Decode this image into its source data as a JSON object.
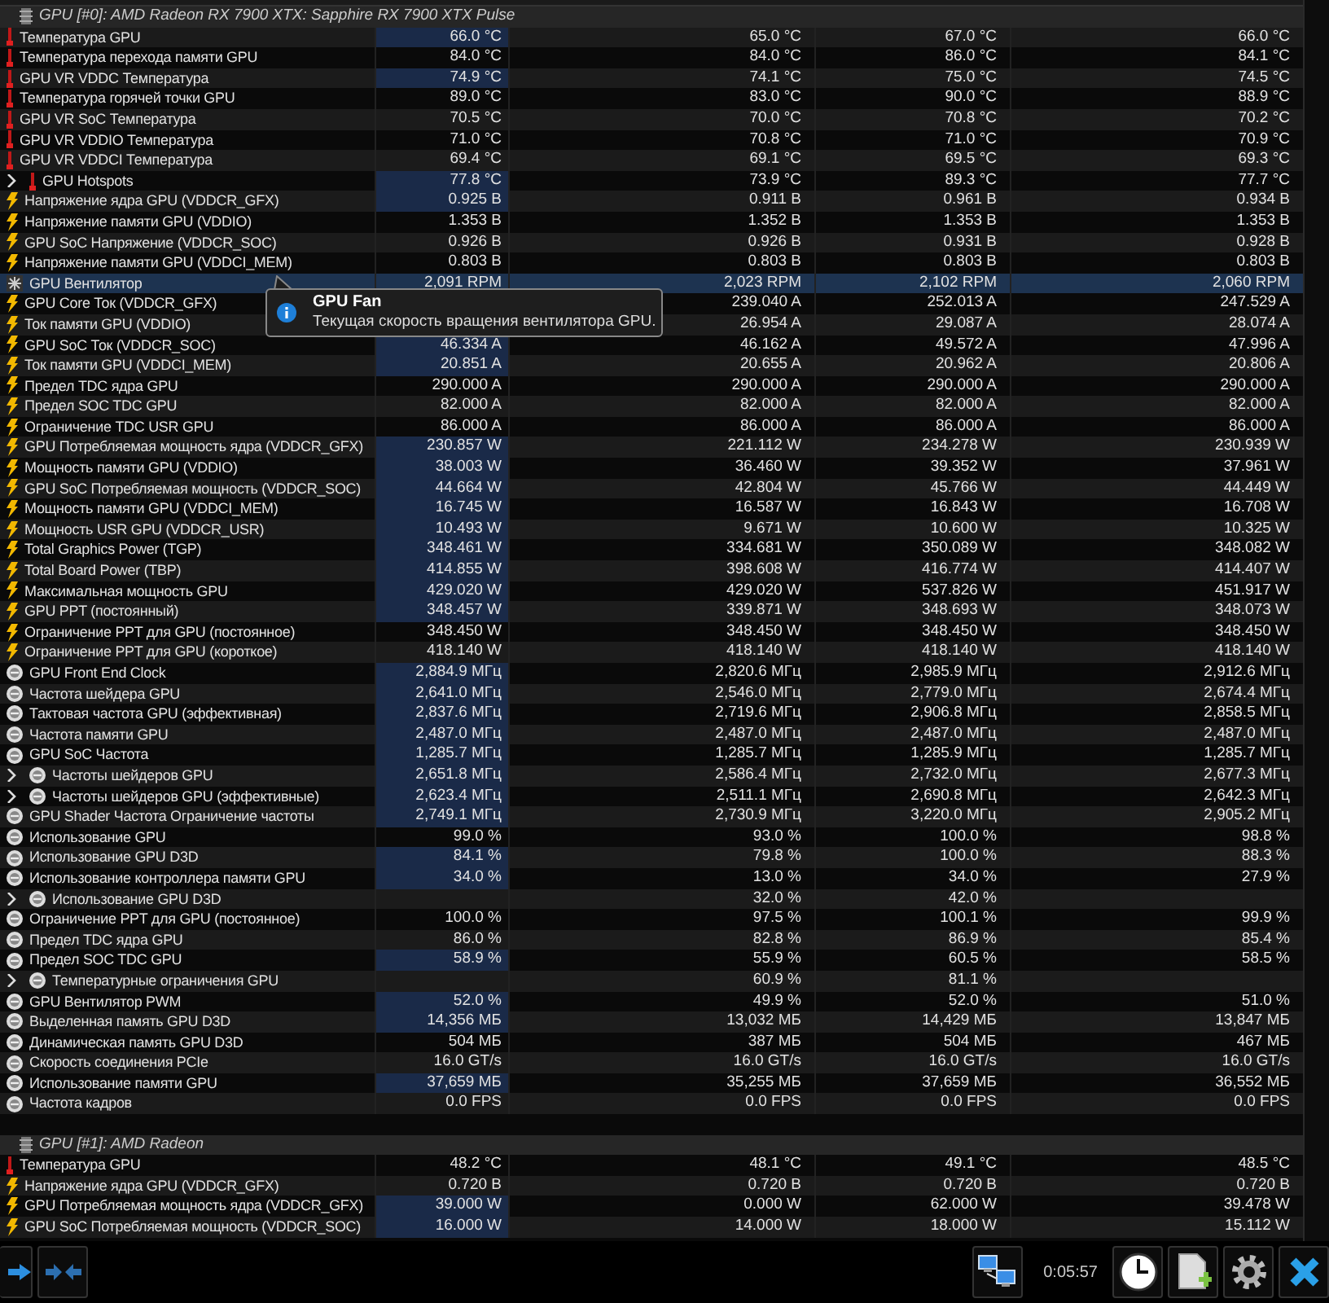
{
  "rows": [
    {
      "kind": "header",
      "label": "GPU [#0]: AMD Radeon RX 7900 XTX: Sapphire RX 7900 XTX Pulse"
    },
    {
      "kind": "temp",
      "label": "Температура GPU",
      "current": "66.0 °C",
      "min": "65.0 °C",
      "max": "67.0 °C",
      "avg": "66.0 °C",
      "highlighted": true,
      "selected": false
    },
    {
      "kind": "temp",
      "label": "Температура перехода памяти GPU",
      "current": "84.0 °C",
      "min": "84.0 °C",
      "max": "86.0 °C",
      "avg": "84.1 °C",
      "highlighted": false,
      "selected": false
    },
    {
      "kind": "temp",
      "label": "GPU VR VDDC Температура",
      "current": "74.9 °C",
      "min": "74.1 °C",
      "max": "75.0 °C",
      "avg": "74.5 °C",
      "highlighted": true,
      "selected": false
    },
    {
      "kind": "temp",
      "label": "Температура горячей точки GPU",
      "current": "89.0 °C",
      "min": "83.0 °C",
      "max": "90.0 °C",
      "avg": "88.9 °C",
      "highlighted": false,
      "selected": false
    },
    {
      "kind": "temp",
      "label": "GPU VR SoC Температура",
      "current": "70.5 °C",
      "min": "70.0 °C",
      "max": "70.8 °C",
      "avg": "70.2 °C",
      "highlighted": false,
      "selected": false
    },
    {
      "kind": "temp",
      "label": "GPU VR VDDIO Температура",
      "current": "71.0 °C",
      "min": "70.8 °C",
      "max": "71.0 °C",
      "avg": "70.9 °C",
      "highlighted": false,
      "selected": false
    },
    {
      "kind": "temp",
      "label": "GPU VR VDDCI Температура",
      "current": "69.4 °C",
      "min": "69.1 °C",
      "max": "69.5 °C",
      "avg": "69.3 °C",
      "highlighted": false,
      "selected": false
    },
    {
      "kind": "temp",
      "expanded": false,
      "label": "GPU Hotspots",
      "current": "77.8 °C",
      "min": "73.9 °C",
      "max": "89.3 °C",
      "avg": "77.7 °C",
      "highlighted": true,
      "selected": false
    },
    {
      "kind": "power",
      "label": "Напряжение ядра GPU (VDDCR_GFX)",
      "current": "0.925 В",
      "min": "0.911 В",
      "max": "0.961 В",
      "avg": "0.934 В",
      "highlighted": true,
      "selected": false
    },
    {
      "kind": "power",
      "label": "Напряжение памяти GPU (VDDIO)",
      "current": "1.353 В",
      "min": "1.352 В",
      "max": "1.353 В",
      "avg": "1.353 В",
      "highlighted": false,
      "selected": false
    },
    {
      "kind": "power",
      "label": "GPU SoC Напряжение (VDDCR_SOC)",
      "current": "0.926 В",
      "min": "0.926 В",
      "max": "0.931 В",
      "avg": "0.928 В",
      "highlighted": false,
      "selected": false
    },
    {
      "kind": "power",
      "label": "Напряжение памяти GPU (VDDCI_MEM)",
      "current": "0.803 В",
      "min": "0.803 В",
      "max": "0.803 В",
      "avg": "0.803 В",
      "highlighted": false,
      "selected": false
    },
    {
      "kind": "fan",
      "label": "GPU Вентилятор",
      "current": "2,091 RPM",
      "min": "2,023 RPM",
      "max": "2,102 RPM",
      "avg": "2,060 RPM",
      "highlighted": false,
      "selected": true
    },
    {
      "kind": "power",
      "label": "GPU Core Ток (VDDCR_GFX)",
      "min": "239.040 A",
      "max": "252.013 A",
      "avg": "247.529 A",
      "selected": false
    },
    {
      "kind": "power",
      "label": "Ток памяти GPU (VDDIO)",
      "min": "26.954 A",
      "max": "29.087 A",
      "avg": "28.074 A",
      "selected": false
    },
    {
      "kind": "power",
      "label": "GPU SoC Ток (VDDCR_SOC)",
      "current": "46.334 A",
      "min": "46.162 A",
      "max": "49.572 A",
      "avg": "47.996 A",
      "highlighted": true,
      "selected": false
    },
    {
      "kind": "power",
      "label": "Ток памяти GPU (VDDCI_MEM)",
      "current": "20.851 A",
      "min": "20.655 A",
      "max": "20.962 A",
      "avg": "20.806 A",
      "highlighted": true,
      "selected": false
    },
    {
      "kind": "power",
      "label": "Предел TDC ядра GPU",
      "current": "290.000 A",
      "min": "290.000 A",
      "max": "290.000 A",
      "avg": "290.000 A",
      "highlighted": false,
      "selected": false
    },
    {
      "kind": "power",
      "label": "Предел SOC TDC GPU",
      "current": "82.000 A",
      "min": "82.000 A",
      "max": "82.000 A",
      "avg": "82.000 A",
      "highlighted": false,
      "selected": false
    },
    {
      "kind": "power",
      "label": "Ограничение TDC USR GPU",
      "current": "86.000 A",
      "min": "86.000 A",
      "max": "86.000 A",
      "avg": "86.000 A",
      "highlighted": false,
      "selected": false
    },
    {
      "kind": "power",
      "label": "GPU Потребляемая мощность ядра (VDDCR_GFX)",
      "current": "230.857 W",
      "min": "221.112 W",
      "max": "234.278 W",
      "avg": "230.939 W",
      "highlighted": true,
      "selected": false
    },
    {
      "kind": "power",
      "label": "Мощность памяти GPU (VDDIO)",
      "current": "38.003 W",
      "min": "36.460 W",
      "max": "39.352 W",
      "avg": "37.961 W",
      "highlighted": true,
      "selected": false
    },
    {
      "kind": "power",
      "label": "GPU SoC Потребляемая мощность (VDDCR_SOC)",
      "current": "44.664 W",
      "min": "42.804 W",
      "max": "45.766 W",
      "avg": "44.449 W",
      "highlighted": true,
      "selected": false
    },
    {
      "kind": "power",
      "label": "Мощность памяти GPU (VDDCI_MEM)",
      "current": "16.745 W",
      "min": "16.587 W",
      "max": "16.843 W",
      "avg": "16.708 W",
      "highlighted": true,
      "selected": false
    },
    {
      "kind": "power",
      "label": "Мощность USR GPU (VDDCR_USR)",
      "current": "10.493 W",
      "min": "9.671 W",
      "max": "10.600 W",
      "avg": "10.325 W",
      "highlighted": true,
      "selected": false
    },
    {
      "kind": "power",
      "label": "Total Graphics Power (TGP)",
      "current": "348.461 W",
      "min": "334.681 W",
      "max": "350.089 W",
      "avg": "348.082 W",
      "highlighted": true,
      "selected": false
    },
    {
      "kind": "power",
      "label": "Total Board Power (TBP)",
      "current": "414.855 W",
      "min": "398.608 W",
      "max": "416.774 W",
      "avg": "414.407 W",
      "highlighted": true,
      "selected": false
    },
    {
      "kind": "power",
      "label": "Максимальная мощность GPU",
      "current": "429.020 W",
      "min": "429.020 W",
      "max": "537.826 W",
      "avg": "451.917 W",
      "highlighted": true,
      "selected": false
    },
    {
      "kind": "power",
      "label": "GPU PPT (постоянный)",
      "current": "348.457 W",
      "min": "339.871 W",
      "max": "348.693 W",
      "avg": "348.073 W",
      "highlighted": true,
      "selected": false
    },
    {
      "kind": "power",
      "label": "Ограничение PPT для GPU (постоянное)",
      "current": "348.450 W",
      "min": "348.450 W",
      "max": "348.450 W",
      "avg": "348.450 W",
      "highlighted": false,
      "selected": false
    },
    {
      "kind": "power",
      "label": "Ограничение PPT для GPU (короткое)",
      "current": "418.140 W",
      "min": "418.140 W",
      "max": "418.140 W",
      "avg": "418.140 W",
      "highlighted": false,
      "selected": false
    },
    {
      "kind": "clock",
      "label": "GPU Front End Clock",
      "current": "2,884.9 МГц",
      "min": "2,820.6 МГц",
      "max": "2,985.9 МГц",
      "avg": "2,912.6 МГц",
      "highlighted": true,
      "selected": false
    },
    {
      "kind": "clock",
      "label": "Частота шейдера GPU",
      "current": "2,641.0 МГц",
      "min": "2,546.0 МГц",
      "max": "2,779.0 МГц",
      "avg": "2,674.4 МГц",
      "highlighted": true,
      "selected": false
    },
    {
      "kind": "clock",
      "label": "Тактовая частота GPU (эффективная)",
      "current": "2,837.6 МГц",
      "min": "2,719.6 МГц",
      "max": "2,906.8 МГц",
      "avg": "2,858.5 МГц",
      "highlighted": true,
      "selected": false
    },
    {
      "kind": "clock",
      "label": "Частота памяти GPU",
      "current": "2,487.0 МГц",
      "min": "2,487.0 МГц",
      "max": "2,487.0 МГц",
      "avg": "2,487.0 МГц",
      "highlighted": true,
      "selected": false
    },
    {
      "kind": "clock",
      "label": "GPU SoC Частота",
      "current": "1,285.7 МГц",
      "min": "1,285.7 МГц",
      "max": "1,285.9 МГц",
      "avg": "1,285.7 МГц",
      "highlighted": true,
      "selected": false
    },
    {
      "kind": "clock",
      "expanded": false,
      "label": "Частоты шейдеров GPU",
      "current": "2,651.8 МГц",
      "min": "2,586.4 МГц",
      "max": "2,732.0 МГц",
      "avg": "2,677.3 МГц",
      "highlighted": true,
      "selected": false
    },
    {
      "kind": "clock",
      "expanded": false,
      "label": "Частоты шейдеров GPU (эффективные)",
      "current": "2,623.4 МГц",
      "min": "2,511.1 МГц",
      "max": "2,690.8 МГц",
      "avg": "2,642.3 МГц",
      "highlighted": true,
      "selected": false
    },
    {
      "kind": "clock",
      "label": "GPU Shader Частота Ограничение частоты",
      "current": "2,749.1 МГц",
      "min": "2,730.9 МГц",
      "max": "3,220.0 МГц",
      "avg": "2,905.2 МГц",
      "highlighted": true,
      "selected": false
    },
    {
      "kind": "clock",
      "label": "Использование GPU",
      "current": "99.0 %",
      "min": "93.0 %",
      "max": "100.0 %",
      "avg": "98.8 %",
      "highlighted": false,
      "selected": false
    },
    {
      "kind": "clock",
      "label": "Использование GPU D3D",
      "current": "84.1 %",
      "min": "79.8 %",
      "max": "100.0 %",
      "avg": "88.3 %",
      "highlighted": true,
      "selected": false
    },
    {
      "kind": "clock",
      "label": "Использование контроллера памяти GPU",
      "current": "34.0 %",
      "min": "13.0 %",
      "max": "34.0 %",
      "avg": "27.9 %",
      "highlighted": true,
      "selected": false
    },
    {
      "kind": "clock",
      "expanded": false,
      "label": "Использование GPU D3D",
      "min": "32.0 %",
      "max": "42.0 %",
      "highlighted": false,
      "selected": false
    },
    {
      "kind": "clock",
      "label": "Ограничение PPT для GPU (постоянное)",
      "current": "100.0 %",
      "min": "97.5 %",
      "max": "100.1 %",
      "avg": "99.9 %",
      "highlighted": false,
      "selected": false
    },
    {
      "kind": "clock",
      "label": "Предел TDC ядра GPU",
      "current": "86.0 %",
      "min": "82.8 %",
      "max": "86.9 %",
      "avg": "85.4 %",
      "highlighted": false,
      "selected": false
    },
    {
      "kind": "clock",
      "label": "Предел SOC TDC GPU",
      "current": "58.9 %",
      "min": "55.9 %",
      "max": "60.5 %",
      "avg": "58.5 %",
      "highlighted": true,
      "selected": false
    },
    {
      "kind": "clock",
      "expanded": false,
      "label": "Температурные ограничения GPU",
      "min": "60.9 %",
      "max": "81.1 %",
      "highlighted": false,
      "selected": false
    },
    {
      "kind": "clock",
      "label": "GPU Вентилятор PWM",
      "current": "52.0 %",
      "min": "49.9 %",
      "max": "52.0 %",
      "avg": "51.0 %",
      "highlighted": true,
      "selected": false
    },
    {
      "kind": "clock",
      "label": "Выделенная память GPU D3D",
      "current": "14,356 МБ",
      "min": "13,032 МБ",
      "max": "14,429 МБ",
      "avg": "13,847 МБ",
      "highlighted": true,
      "selected": false
    },
    {
      "kind": "clock",
      "label": "Динамическая память GPU D3D",
      "current": "504 МБ",
      "min": "387 МБ",
      "max": "504 МБ",
      "avg": "467 МБ",
      "highlighted": false,
      "selected": false
    },
    {
      "kind": "clock",
      "label": "Скорость соединения PCIe",
      "current": "16.0 GT/s",
      "min": "16.0 GT/s",
      "max": "16.0 GT/s",
      "avg": "16.0 GT/s",
      "highlighted": false,
      "selected": false
    },
    {
      "kind": "clock",
      "label": "Использование памяти GPU",
      "current": "37,659 МБ",
      "min": "35,255 МБ",
      "max": "37,659 МБ",
      "avg": "36,552 МБ",
      "highlighted": true,
      "selected": false
    },
    {
      "kind": "clock",
      "label": "Частота кадров",
      "current": "0.0 FPS",
      "min": "0.0 FPS",
      "max": "0.0 FPS",
      "avg": "0.0 FPS",
      "highlighted": false,
      "selected": false
    },
    {
      "kind": "blank"
    },
    {
      "kind": "header",
      "label": "GPU [#1]: AMD Radeon"
    },
    {
      "kind": "temp",
      "label": "Температура GPU",
      "current": "48.2 °C",
      "min": "48.1 °C",
      "max": "49.1 °C",
      "avg": "48.5 °C",
      "highlighted": false,
      "selected": false
    },
    {
      "kind": "power",
      "label": "Напряжение ядра GPU (VDDCR_GFX)",
      "current": "0.720 В",
      "min": "0.720 В",
      "max": "0.720 В",
      "avg": "0.720 В",
      "highlighted": false,
      "selected": false
    },
    {
      "kind": "power",
      "label": "GPU Потребляемая мощность ядра (VDDCR_GFX)",
      "current": "39.000 W",
      "min": "0.000 W",
      "max": "62.000 W",
      "avg": "39.478 W",
      "highlighted": true,
      "selected": false
    },
    {
      "kind": "power",
      "label": "GPU SoC Потребляемая мощность (VDDCR_SOC)",
      "current": "16.000 W",
      "min": "14.000 W",
      "max": "18.000 W",
      "avg": "15.112 W",
      "highlighted": true,
      "selected": false
    }
  ],
  "tooltip": {
    "title": "GPU Fan",
    "text": "Текущая скорость вращения вентилятора GPU."
  },
  "toolbar": {
    "elapsed": "0:05:57"
  }
}
